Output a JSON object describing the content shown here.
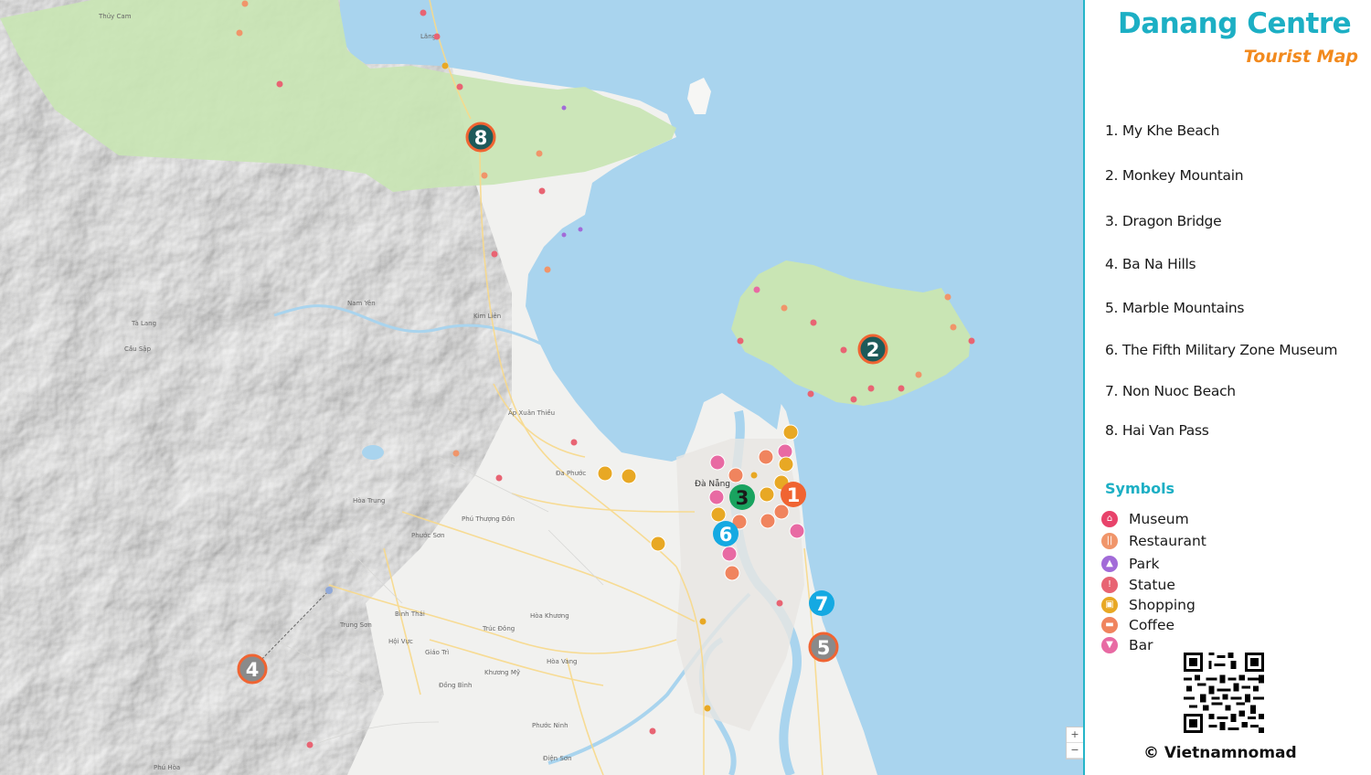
{
  "title": "Danang Centre",
  "subtitle": "Tourist Map",
  "attractions": [
    {
      "num": "1",
      "label": "1. My Khe Beach"
    },
    {
      "num": "2",
      "label": "2. Monkey Mountain"
    },
    {
      "num": "3",
      "label": "3. Dragon Bridge"
    },
    {
      "num": "4",
      "label": "4. Ba Na Hills"
    },
    {
      "num": "5",
      "label": "5. Marble Mountains"
    },
    {
      "num": "6",
      "label": "6. The Fifth Military Zone Museum"
    },
    {
      "num": "7",
      "label": "7. Non Nuoc Beach"
    },
    {
      "num": "8",
      "label": "8. Hai Van Pass"
    }
  ],
  "symbols_heading": "Symbols",
  "symbols": [
    {
      "label": "Museum",
      "color": "#e8436b",
      "icon": "museum-icon"
    },
    {
      "label": "Restaurant",
      "color": "#f0956a",
      "icon": "restaurant-icon"
    },
    {
      "label": "Park",
      "color": "#a26bd8",
      "icon": "park-icon"
    },
    {
      "label": "Statue",
      "color": "#e86473",
      "icon": "statue-icon"
    },
    {
      "label": "Shopping",
      "color": "#e8a824",
      "icon": "shopping-cart-icon"
    },
    {
      "label": "Coffee",
      "color": "#f0845e",
      "icon": "coffee-icon"
    },
    {
      "label": "Bar",
      "color": "#e86aa3",
      "icon": "bar-icon"
    }
  ],
  "map_labels": {
    "danang": "Đà Nẵng",
    "nam_yen": "Nam Yên",
    "kim_lien": "Kim Liên",
    "lang": "Lăng",
    "thuy_cam": "Thủy Cam",
    "ap_xuan_thieu": "Ấp Xuân Thiều",
    "hoa_phuoc": "Đa Phước",
    "hoa_trung": "Hòa Trung",
    "phu_thuong": "Phú Thượng Đôn",
    "phuoc_son": "Phước Sơn",
    "binh_thai": "Bình Thái",
    "trung_son": "Trung Sơn",
    "giao_tri": "Giáo Trì",
    "hoi_vuc": "Hội Vực",
    "hoa_khuong": "Hòa Khương",
    "hoa_vang": "Hòa Vang",
    "dong_binh": "Đồng Bình",
    "phuoc_ninh": "Phước Ninh",
    "phu_hoa": "Phú Hòa",
    "ta_lang": "Tà Lang",
    "cau_sap": "Cầu Sập",
    "khuong_my": "Khương Mỹ",
    "truc_dong": "Trúc Đông",
    "dien_son": "Điện Sơn"
  },
  "zoom": {
    "plus": "+",
    "minus": "−"
  },
  "credit": "© Vietnamnomad",
  "colors": {
    "sea": "#a9d4ee",
    "land": "#f2f2f0",
    "park": "#c9e5b4",
    "accent": "#1cafc4",
    "orange": "#f28a1e",
    "marker_ring": "#f06432",
    "marker_dark": "#1d5a5a",
    "marker_green": "#19a35f",
    "marker_blue": "#15a9e2",
    "marker_grey": "#8a8a8a"
  }
}
